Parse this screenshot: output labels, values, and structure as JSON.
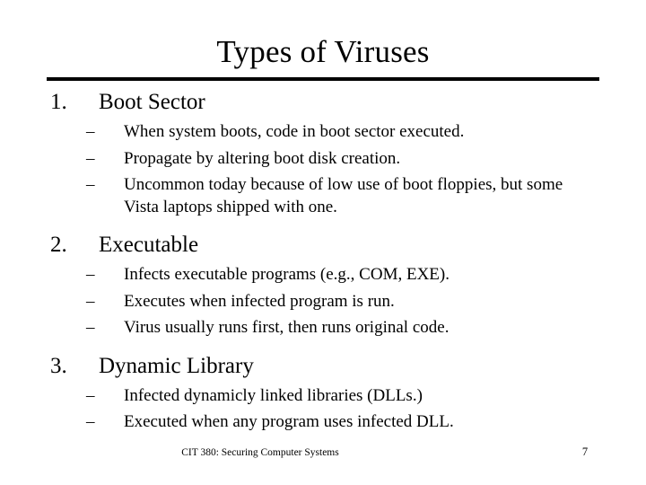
{
  "slide": {
    "title": "Types of Viruses",
    "has_title_rule": true,
    "colors": {
      "background": "#ffffff",
      "text": "#000000",
      "rule": "#000000"
    },
    "items": [
      {
        "marker": "1.",
        "heading": "Boot Sector",
        "bullets": [
          {
            "dash": "–",
            "text": "When system boots, code in boot sector executed."
          },
          {
            "dash": "–",
            "text": "Propagate by altering boot disk creation."
          },
          {
            "dash": "–",
            "text": "Uncommon today because of low use of boot floppies, but some Vista laptops shipped with one."
          }
        ]
      },
      {
        "marker": "2.",
        "heading": "Executable",
        "bullets": [
          {
            "dash": "–",
            "text": "Infects executable programs (e.g., COM, EXE)."
          },
          {
            "dash": "–",
            "text": "Executes when infected program is run."
          },
          {
            "dash": "–",
            "text": "Virus usually runs first, then runs original code."
          }
        ]
      },
      {
        "marker": "3.",
        "heading": "Dynamic Library",
        "bullets": [
          {
            "dash": "–",
            "text": "Infected dynamicly linked libraries (DLLs.)"
          },
          {
            "dash": "–",
            "text": "Executed when any program uses infected DLL."
          }
        ]
      }
    ],
    "footer": {
      "course": "CIT 380: Securing Computer Systems",
      "page_number": "7"
    }
  }
}
